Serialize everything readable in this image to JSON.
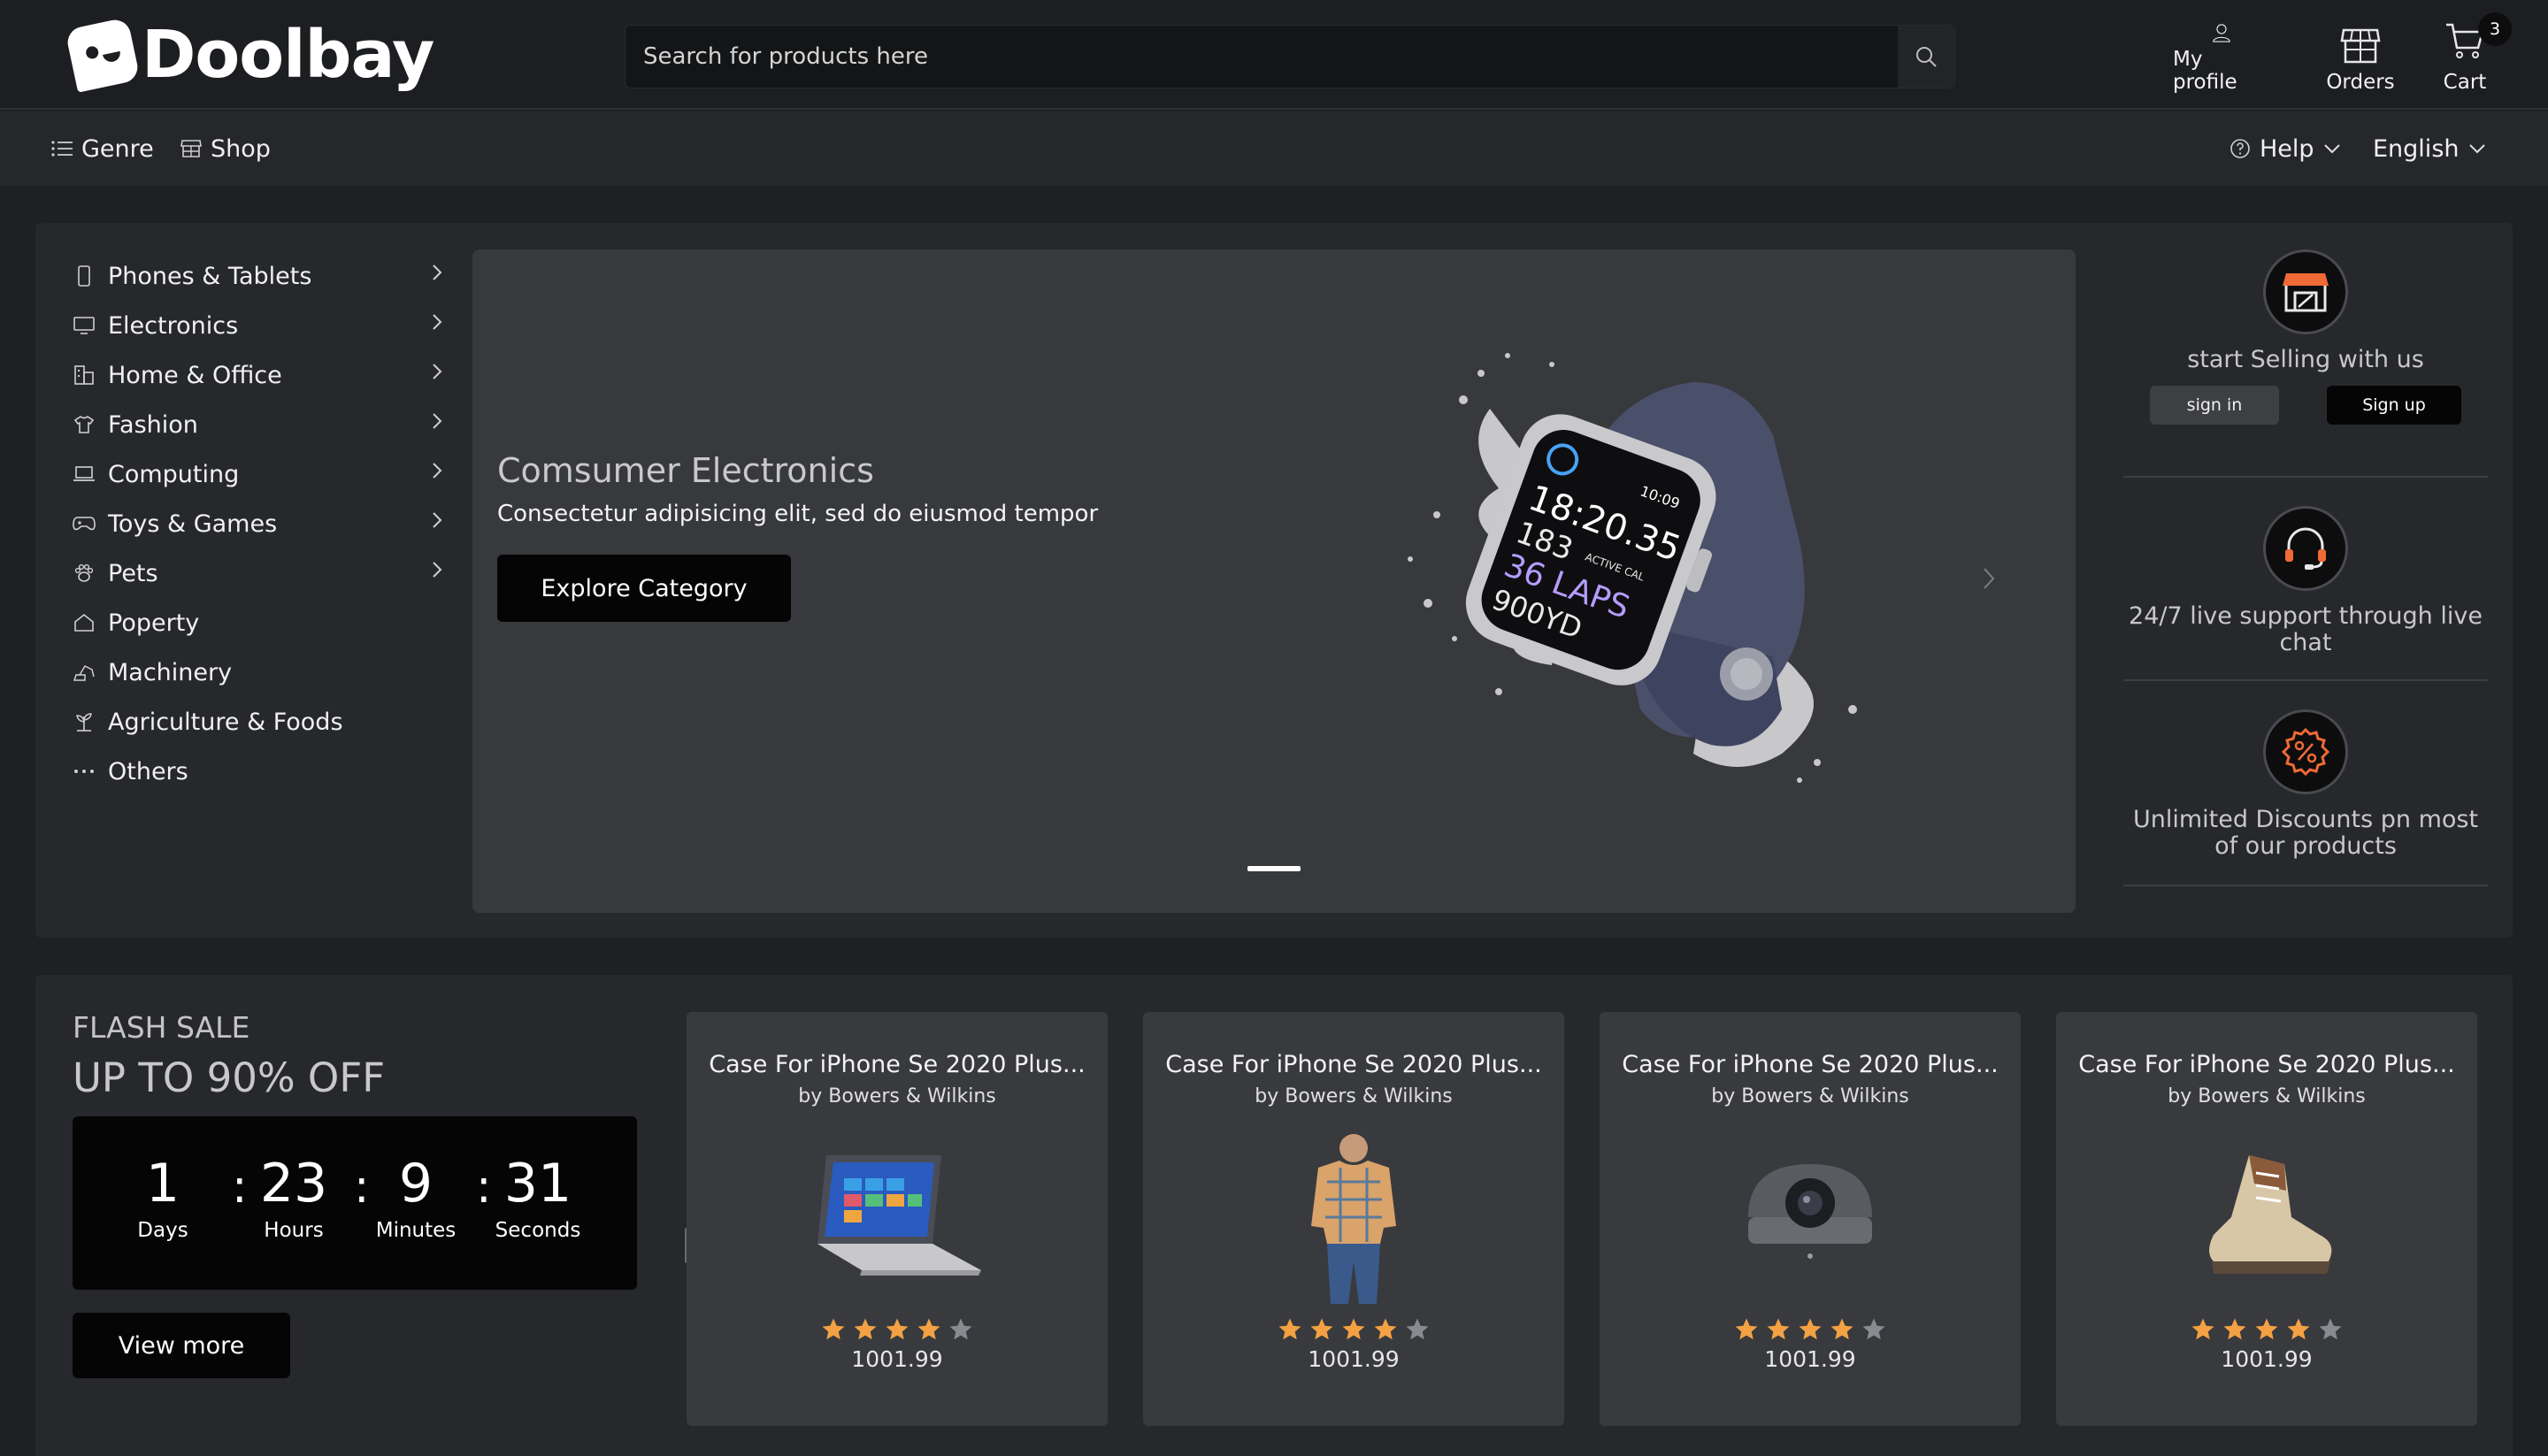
{
  "brand": {
    "name": "Doolbay"
  },
  "search": {
    "placeholder": "Search for products here"
  },
  "header_actions": {
    "profile": "My profile",
    "orders": "Orders",
    "cart": "Cart",
    "cart_count": "3"
  },
  "subnav": {
    "genre": "Genre",
    "shop": "Shop",
    "help": "Help",
    "language": "English"
  },
  "categories": [
    {
      "label": "Phones & Tablets",
      "icon": "phone-icon",
      "has_submenu": true
    },
    {
      "label": "Electronics",
      "icon": "monitor-icon",
      "has_submenu": true
    },
    {
      "label": "Home & Office",
      "icon": "building-icon",
      "has_submenu": true
    },
    {
      "label": "Fashion",
      "icon": "shirt-icon",
      "has_submenu": true
    },
    {
      "label": "Computing",
      "icon": "laptop-icon",
      "has_submenu": true
    },
    {
      "label": "Toys & Games",
      "icon": "gamepad-icon",
      "has_submenu": true
    },
    {
      "label": "Pets",
      "icon": "paw-icon",
      "has_submenu": true
    },
    {
      "label": "Poperty",
      "icon": "house-icon",
      "has_submenu": false
    },
    {
      "label": "Machinery",
      "icon": "excavator-icon",
      "has_submenu": false
    },
    {
      "label": "Agriculture & Foods",
      "icon": "plant-icon",
      "has_submenu": false
    },
    {
      "label": "Others",
      "icon": "dots-icon",
      "has_submenu": false
    }
  ],
  "banner": {
    "title": "Comsumer Electronics",
    "subtitle": "Consectetur adipisicing elit, sed do eiusmod tempor",
    "cta": "Explore Category",
    "watch_readout": {
      "time": "10:09",
      "line1": "18:20.35",
      "line2": "183",
      "line2_unit": "ACTIVE CAL",
      "line3": "36 LAPS",
      "line4": "900YD"
    }
  },
  "perks": {
    "selling": "start Selling with us",
    "sign_in": "sign in",
    "sign_up": "Sign up",
    "support": "24/7 live support through live chat",
    "discounts": "Unlimited Discounts pn most of our products"
  },
  "flash_sale": {
    "label": "FLASH SALE",
    "headline": "UP TO 90% OFF",
    "countdown": {
      "days": "1",
      "days_label": "Days",
      "hours": "23",
      "hours_label": "Hours",
      "minutes": "9",
      "minutes_label": "Minutes",
      "seconds": "31",
      "seconds_label": "Seconds"
    },
    "view_more": "View more"
  },
  "products": [
    {
      "title": "Case For iPhone Se 2020 Plus...",
      "by": "by Bowers & Wilkins",
      "image": "laptop",
      "rating": 4,
      "price": "1001.99"
    },
    {
      "title": "Case For iPhone Se 2020 Plus...",
      "by": "by Bowers & Wilkins",
      "image": "shirt",
      "rating": 4,
      "price": "1001.99"
    },
    {
      "title": "Case For iPhone Se 2020 Plus...",
      "by": "by Bowers & Wilkins",
      "image": "camera",
      "rating": 4,
      "price": "1001.99"
    },
    {
      "title": "Case For iPhone Se 2020 Plus...",
      "by": "by Bowers & Wilkins",
      "image": "shoe",
      "rating": 4,
      "price": "1001.99"
    }
  ],
  "colors": {
    "page_bg": "#1f2023",
    "panel_bg": "#27282b",
    "card_bg": "#393a3e",
    "button_bg": "#050505",
    "star_filled": "#f3a143",
    "star_empty": "#8a8b90",
    "accent_orange": "#f06a35"
  }
}
